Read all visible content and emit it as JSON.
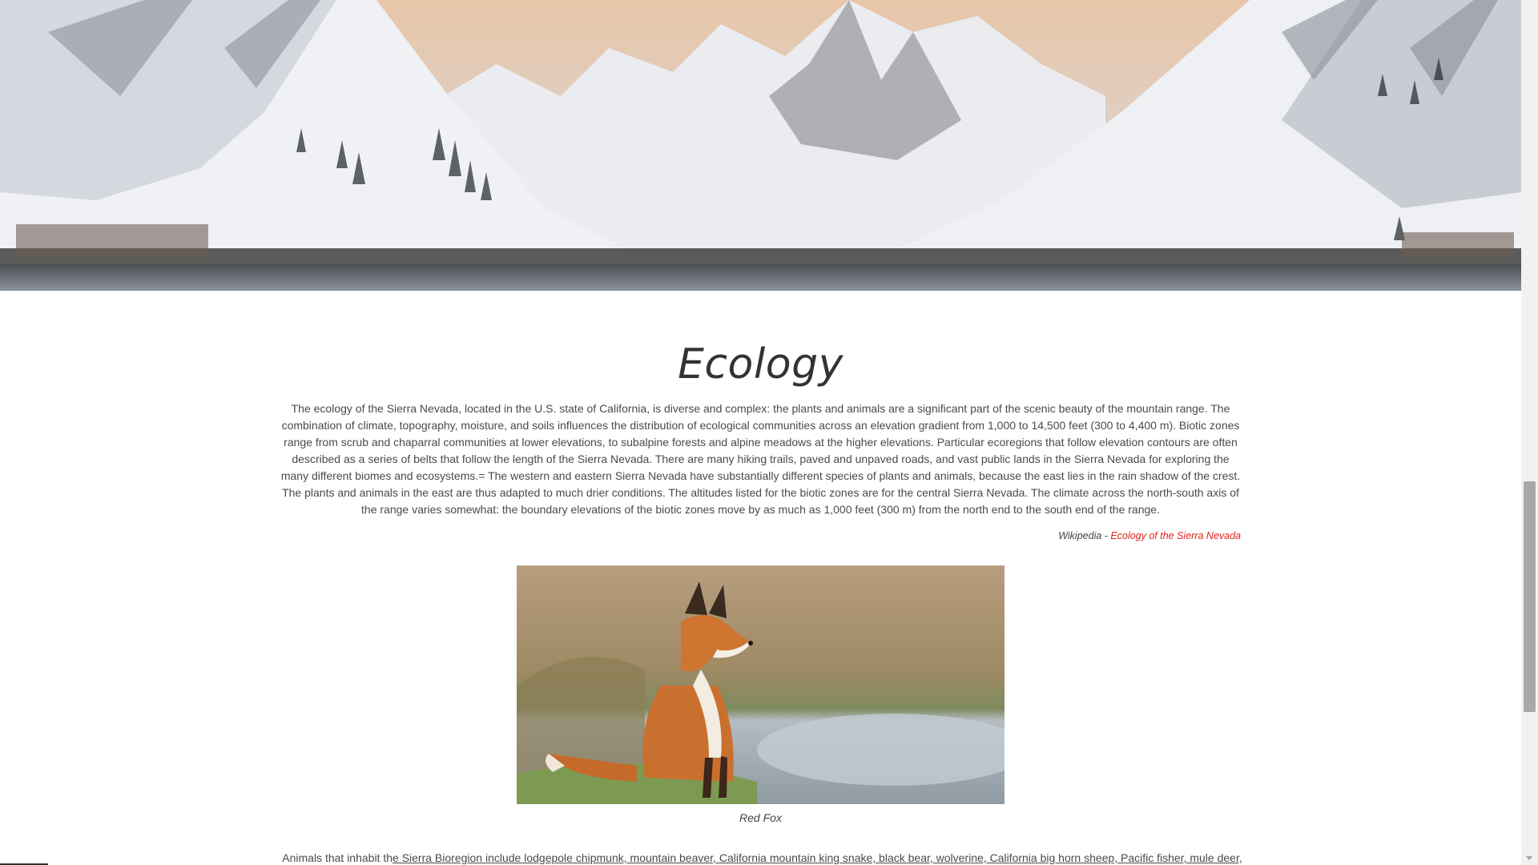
{
  "hero": {
    "image_alt": "Snow-covered mountain valley with lake"
  },
  "section": {
    "title": "Ecology",
    "paragraph": "The ecology of the Sierra Nevada, located in the U.S. state of California, is diverse and complex: the plants and animals are a significant part of the scenic beauty of the mountain range. The combination of climate, topography, moisture, and soils influences the distribution of ecological communities across an elevation gradient from 1,000 to 14,500 feet (300 to 4,400 m). Biotic zones range from scrub and chaparral communities at lower elevations, to subalpine forests and alpine meadows at the higher elevations. Particular ecoregions that follow elevation contours are often described as a series of belts that follow the length of the Sierra Nevada. There are many hiking trails, paved and unpaved roads, and vast public lands in the Sierra Nevada for exploring the many different biomes and ecosystems.= The western and eastern Sierra Nevada have substantially different species of plants and animals, because the east lies in the rain shadow of the crest. The plants and animals in the east are thus adapted to much drier conditions. The altitudes listed for the biotic zones are for the central Sierra Nevada. The climate across the north-south axis of the range varies somewhat: the boundary elevations of the biotic zones move by as much as 1,000 feet (300 m) from the north end to the south end of the range.",
    "citation_source": "Wikipedia - ",
    "citation_link": "Ecology of the Sierra Nevada"
  },
  "figure": {
    "caption": "Red Fox"
  },
  "next": {
    "before": "Animals that inhabit th",
    "underlined": "e Sierra Bioregion include lodgepole chipmunk, mountain beaver, California mountain king snake, black bear, wolverine, California big horn sheep, Pacific fisher, mule deer,"
  },
  "colors": {
    "link": "#e0251b",
    "text": "#4a4a4a"
  }
}
